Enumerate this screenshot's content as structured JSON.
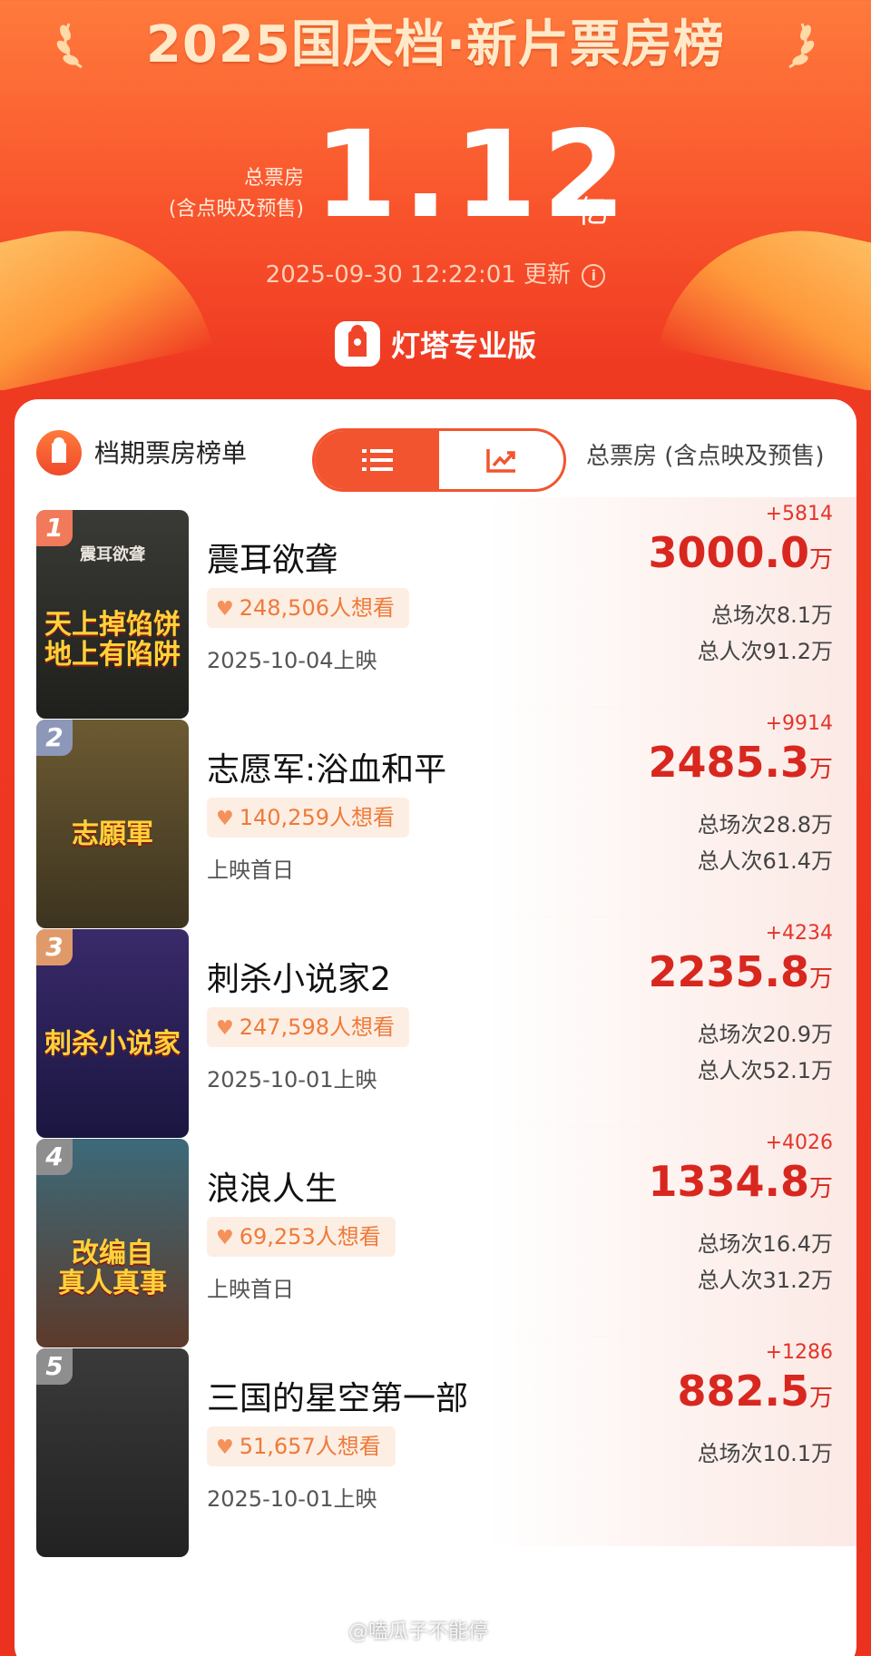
{
  "header": {
    "title": "2025国庆档·新片票房榜",
    "total_label_line1": "总票房",
    "total_label_line2": "(含点映及预售)",
    "total_value": "1.12",
    "total_unit": "亿",
    "update_time": "2025-09-30 12:22:01 更新",
    "brand": "灯塔专业版"
  },
  "list": {
    "title": "档期票房榜单",
    "column_header": "总票房 (含点映及预售)",
    "view_modes": [
      "list-icon",
      "trend-chart-icon"
    ],
    "active_view": "list-icon",
    "unit": "万",
    "items": [
      {
        "rank": "1",
        "title": "震耳欲聋",
        "want": "248,506人想看",
        "release": "2025-10-04上映",
        "delta": "+5814",
        "gross": "3000.0",
        "sessions": "总场次8.1万",
        "admissions": "总人次91.2万",
        "poster_text": "天上掉馅饼\n地上有陷阱",
        "poster_sub": "震耳欲聋",
        "badge_color": "#f07a5a",
        "poster_colors": [
          "#3a3a36",
          "#1f1f1c"
        ]
      },
      {
        "rank": "2",
        "title": "志愿军:浴血和平",
        "want": "140,259人想看",
        "release": "上映首日",
        "delta": "+9914",
        "gross": "2485.3",
        "sessions": "总场次28.8万",
        "admissions": "总人次61.4万",
        "poster_text": "志願軍",
        "poster_sub": "",
        "badge_color": "#8d98b8",
        "poster_colors": [
          "#6c5a32",
          "#3d3420"
        ]
      },
      {
        "rank": "3",
        "title": "刺杀小说家2",
        "want": "247,598人想看",
        "release": "2025-10-01上映",
        "delta": "+4234",
        "gross": "2235.8",
        "sessions": "总场次20.9万",
        "admissions": "总人次52.1万",
        "poster_text": "刺杀小说家",
        "poster_sub": "",
        "badge_color": "#e09a6a",
        "poster_colors": [
          "#3a2a6a",
          "#1a1640"
        ]
      },
      {
        "rank": "4",
        "title": "浪浪人生",
        "want": "69,253人想看",
        "release": "上映首日",
        "delta": "+4026",
        "gross": "1334.8",
        "sessions": "总场次16.4万",
        "admissions": "总人次31.2万",
        "poster_text": "改编自\n真人真事",
        "poster_sub": "",
        "badge_color": "#8e8e8e",
        "poster_colors": [
          "#3c6a7a",
          "#5c3a2a"
        ]
      },
      {
        "rank": "5",
        "title": "三国的星空第一部",
        "want": "51,657人想看",
        "release": "2025-10-01上映",
        "delta": "+1286",
        "gross": "882.5",
        "sessions": "总场次10.1万",
        "admissions": "",
        "poster_text": "",
        "poster_sub": "",
        "badge_color": "#8e8e8e",
        "poster_colors": [
          "#3a3a3a",
          "#222222"
        ]
      }
    ]
  },
  "watermark": "@嗑瓜子不能停"
}
